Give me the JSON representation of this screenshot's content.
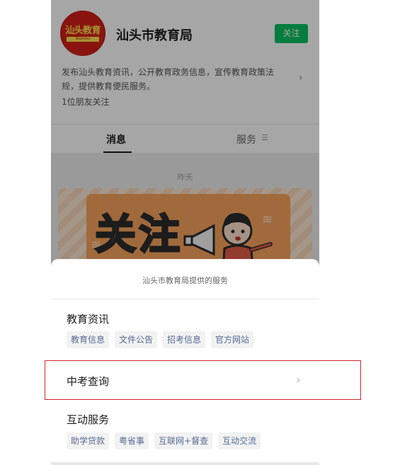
{
  "account": {
    "logo_text": "汕头教育",
    "logo_subtext": "Shantou Education",
    "name": "汕头市教育局",
    "follow_label": "关注",
    "description": "发布汕头教育资讯，公开教育政务信息，宣传教育政策法规，提供教育便民服务。",
    "friends_following": "1位朋友关注"
  },
  "tabs": [
    {
      "label": "消息",
      "active": true
    },
    {
      "label": "服务",
      "active": false
    }
  ],
  "feed": {
    "date_label": "昨天",
    "banner_title": "关注"
  },
  "sheet": {
    "title": "汕头市教育局提供的服务",
    "groups": [
      {
        "title": "教育资讯",
        "items": [
          "教育信息",
          "文件公告",
          "招考信息",
          "官方网站"
        ]
      },
      {
        "title": "中考查询",
        "items": []
      },
      {
        "title": "互动服务",
        "items": [
          "助学贷款",
          "粤省事",
          "互联网+督查",
          "互动交流"
        ]
      }
    ]
  },
  "colors": {
    "follow_button": "#07c160",
    "chip_text": "#576b95",
    "highlight_border": "#d0262e",
    "logo_red": "#d32018"
  }
}
